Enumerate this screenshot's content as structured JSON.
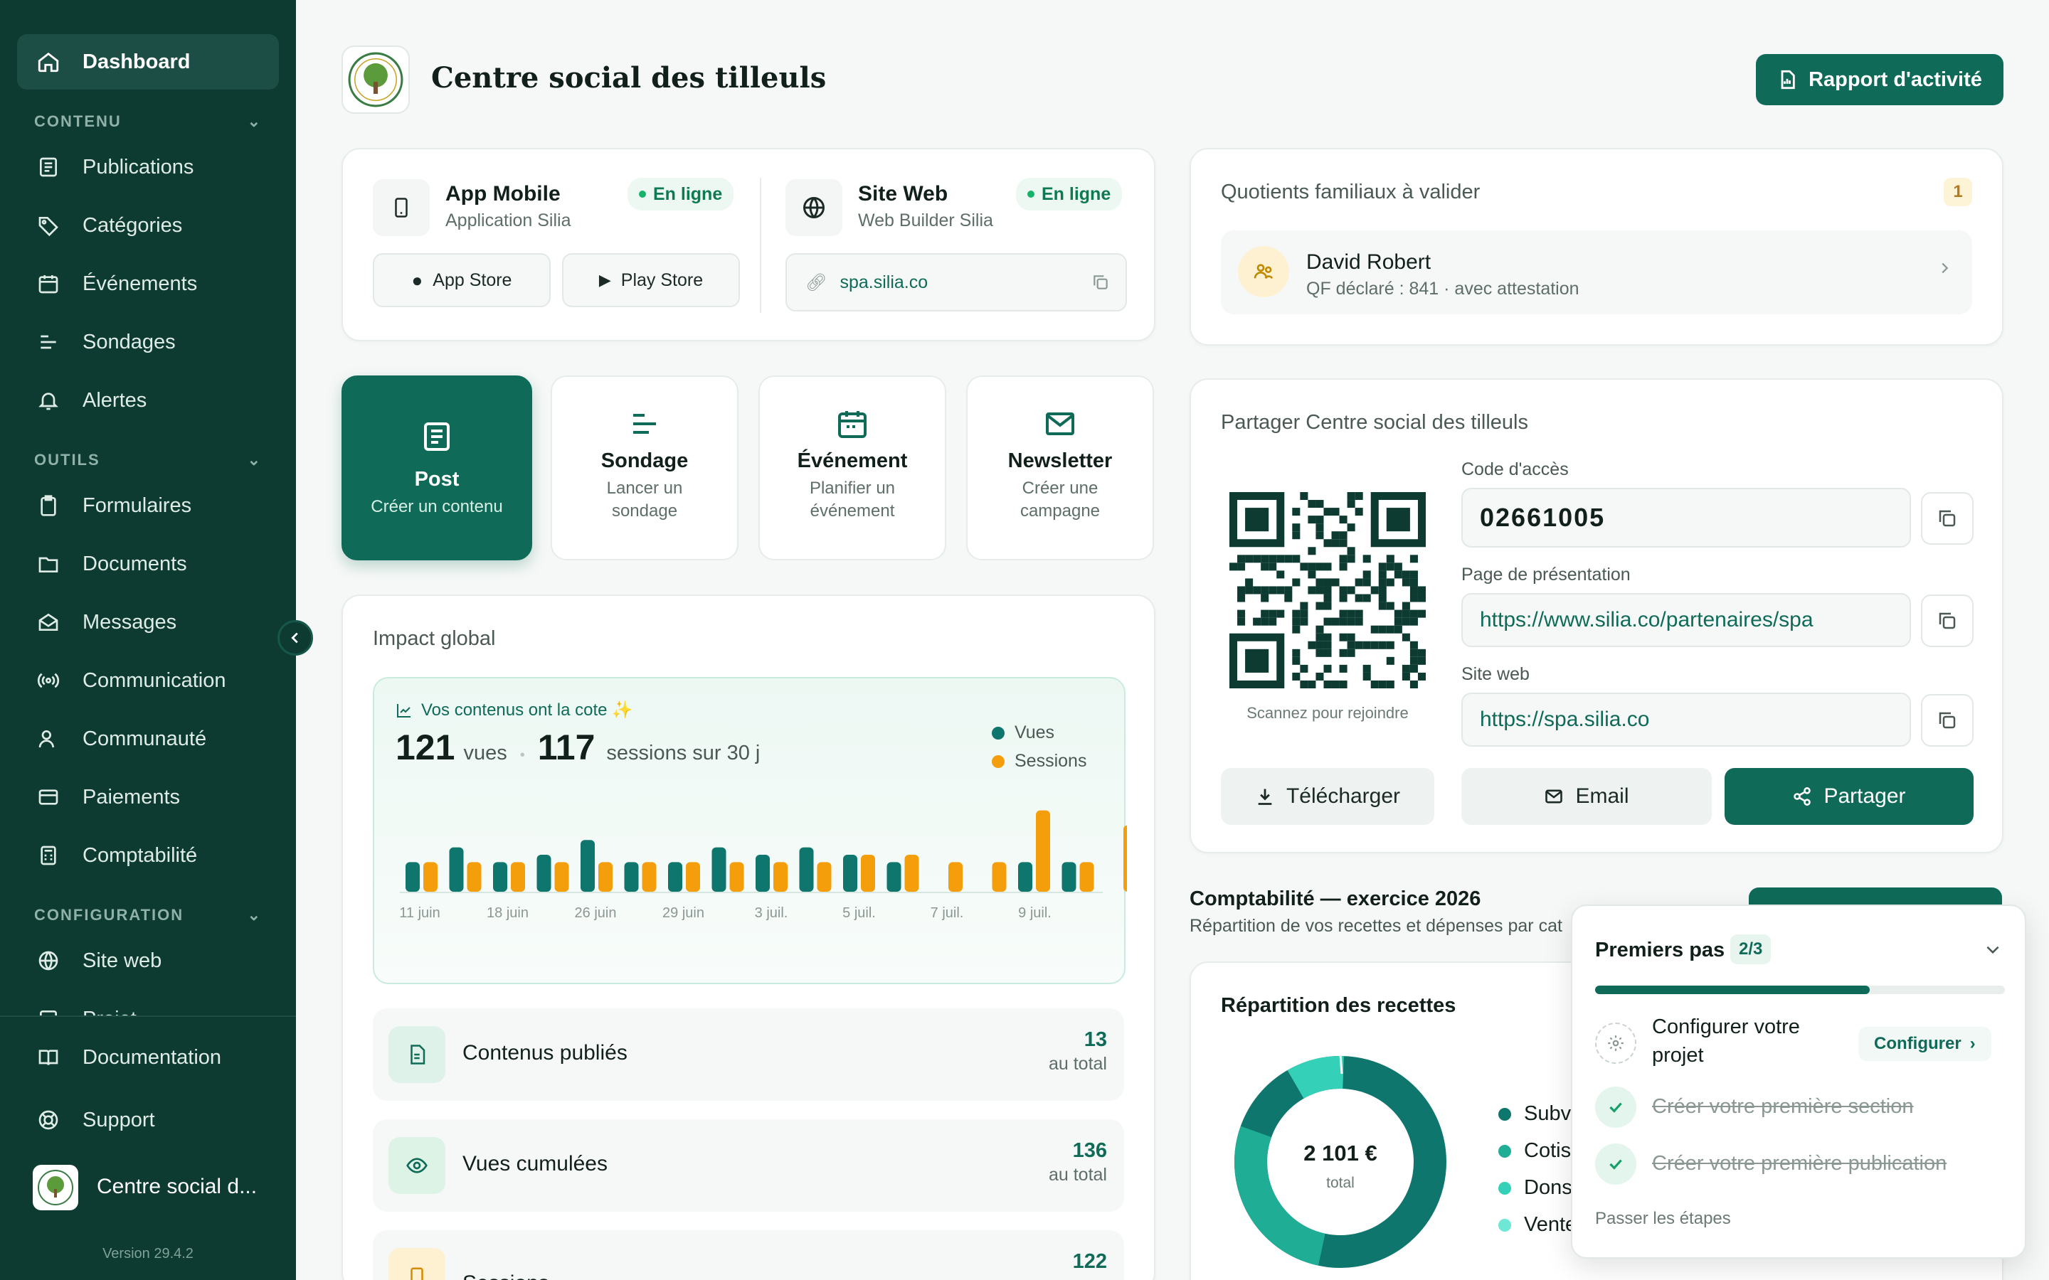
{
  "sidebar": {
    "dashboard": "Dashboard",
    "section_contenu": "CONTENU",
    "publications": "Publications",
    "categories": "Catégories",
    "evenements": "Événements",
    "sondages": "Sondages",
    "alertes": "Alertes",
    "section_outils": "OUTILS",
    "formulaires": "Formulaires",
    "documents": "Documents",
    "messages": "Messages",
    "communication": "Communication",
    "communaute": "Communauté",
    "paiements": "Paiements",
    "comptabilite": "Comptabilité",
    "section_config": "CONFIGURATION",
    "site_web": "Site web",
    "projet": "Projet",
    "documentation": "Documentation",
    "support": "Support",
    "org_name": "Centre social d...",
    "version": "Version 29.4.2"
  },
  "header": {
    "title": "Centre social des tilleuls",
    "report_button": "Rapport d'activité"
  },
  "apps": {
    "mobile_title": "App Mobile",
    "mobile_sub": "Application Silia",
    "mobile_status": "En ligne",
    "app_store": "App Store",
    "play_store": "Play Store",
    "web_title": "Site Web",
    "web_sub": "Web Builder Silia",
    "web_status": "En ligne",
    "web_url": "spa.silia.co"
  },
  "quick_actions": {
    "post_title": "Post",
    "post_sub": "Créer un contenu",
    "sondage_title": "Sondage",
    "sondage_sub": "Lancer un sondage",
    "event_title": "Événement",
    "event_sub": "Planifier un événement",
    "news_title": "Newsletter",
    "news_sub": "Créer une campagne"
  },
  "impact": {
    "title": "Impact global",
    "banner": "Vos contenus ont la cote",
    "views_num": "121",
    "views_word": "vues",
    "sessions_num": "117",
    "sessions_word": "sessions sur 30 j",
    "stat1_label": "Contenus publiés",
    "stat1_value": "13",
    "stat1_sub": "au total",
    "stat2_label": "Vues cumulées",
    "stat2_value": "136",
    "stat2_sub": "au total",
    "stat3_label": "Sessions",
    "stat3_value": "122"
  },
  "chart_data": {
    "type": "bar",
    "categories": [
      "",
      "",
      "",
      "",
      "",
      "",
      "",
      "",
      "",
      "",
      "",
      "",
      "",
      "",
      "",
      "",
      "",
      "",
      "",
      "",
      "",
      "",
      "",
      "",
      "",
      ""
    ],
    "tick_labels": [
      "11 juin",
      "18 juin",
      "26 juin",
      "29 juin",
      "3 juil.",
      "5 juil.",
      "7 juil.",
      "9 juil."
    ],
    "series": [
      {
        "name": "Vues",
        "color": "#0f766e",
        "values": [
          4,
          6,
          4,
          5,
          7,
          4,
          4,
          6,
          5,
          6,
          5,
          4,
          0,
          0,
          4,
          4,
          0
        ]
      },
      {
        "name": "Sessions",
        "color": "#f59e0b",
        "values": [
          4,
          4,
          4,
          4,
          4,
          4,
          4,
          4,
          4,
          4,
          5,
          5,
          4,
          4,
          11,
          4,
          9
        ]
      }
    ],
    "grid": false,
    "legend": "top-right"
  },
  "qf": {
    "title": "Quotients familiaux à valider",
    "count": "1",
    "name": "David Robert",
    "detail": "QF déclaré : 841 · avec attestation"
  },
  "share": {
    "title": "Partager Centre social des tilleuls",
    "qr_caption": "Scannez pour rejoindre",
    "code_label": "Code d'accès",
    "code_value": "02661005",
    "page_label": "Page de présentation",
    "page_value": "https://www.silia.co/partenaires/spa",
    "site_label": "Site web",
    "site_value": "https://spa.silia.co",
    "download": "Télécharger",
    "email": "Email",
    "share": "Partager"
  },
  "compta": {
    "title": "Comptabilité — exercice 2026",
    "subtitle": "Répartition de vos recettes et dépenses par cat",
    "card_title": "Répartition des recettes",
    "total": "2 101 €",
    "total_label": "total",
    "legend": [
      "Subv",
      "Cotis",
      "Dons",
      "Vente"
    ]
  },
  "onboarding": {
    "title": "Premiers pas",
    "progress_label": "2/3",
    "progress": 0.67,
    "step1": "Configurer votre projet",
    "step1_button": "Configurer",
    "step2": "Créer votre première section",
    "step3": "Créer votre première publication",
    "skip": "Passer les étapes"
  }
}
